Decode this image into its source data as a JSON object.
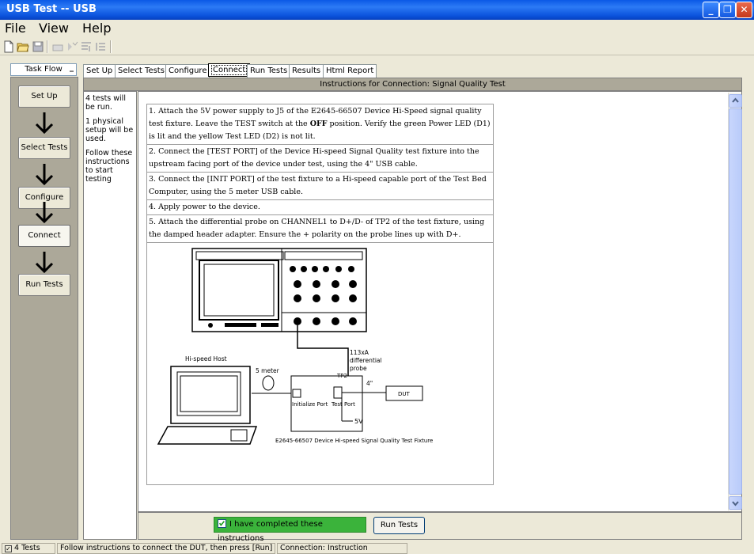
{
  "window": {
    "title": "USB Test -- USB"
  },
  "menu": [
    "File",
    "View",
    "Help"
  ],
  "taskflow": {
    "header": "Task Flow",
    "steps": [
      "Set Up",
      "Select Tests",
      "Configure",
      "Connect",
      "Run Tests"
    ],
    "active": "Connect"
  },
  "tabs": [
    "Set Up",
    "Select Tests",
    "Configure",
    "Connect",
    "Run Tests",
    "Results",
    "Html Report"
  ],
  "instructions": {
    "header": "Instructions for Connection: Signal Quality Test",
    "side_notes": [
      "4 tests will be run.",
      "1 physical setup will be used.",
      "Follow these instructions to start testing"
    ],
    "steps": [
      "1. Attach the 5V power supply to J5 of the E2645-66507 Device Hi-Speed signal quality test fixture. Leave the TEST switch at the ",
      "2. Connect the [TEST PORT] of the Device Hi-speed Signal Quality test fixture into the upstream facing port of the device under test, using the 4\" USB cable.",
      "3. Connect the [INIT PORT] of the test fixture to a Hi-speed capable port of the Test Bed Computer, using the 5 meter USB cable.",
      "4. Apply power to the device.",
      "5. Attach the differential probe on CHANNEL1 to D+/D- of TP2 of the test fixture, using the damped header adapter. Ensure the + polarity on the probe lines up with D+."
    ],
    "step1_bold": "OFF",
    "step1_rest": " position. Verify the green Power LED (D1) is lit and the yellow Test LED (D2) is not lit."
  },
  "diagram": {
    "probe_label": [
      "113xA",
      "differential",
      "probe"
    ],
    "host_label": "Hi-speed Host",
    "cable_label": "5 meter",
    "tp2": "TP2",
    "four_inch": "4\"",
    "dut": "DUT",
    "init_port": "Initialize Port",
    "test_port": "Test Port",
    "five_v": "5V",
    "fixture_caption": "E2645-66507 Device Hi-speed Signal Quality Test Fixture"
  },
  "bottom": {
    "checkbox_label": "I have completed these instructions",
    "run_button": "Run Tests"
  },
  "status": [
    "4 Tests",
    "Follow instructions to connect the DUT, then press [Run]",
    "Connection: Instruction"
  ]
}
